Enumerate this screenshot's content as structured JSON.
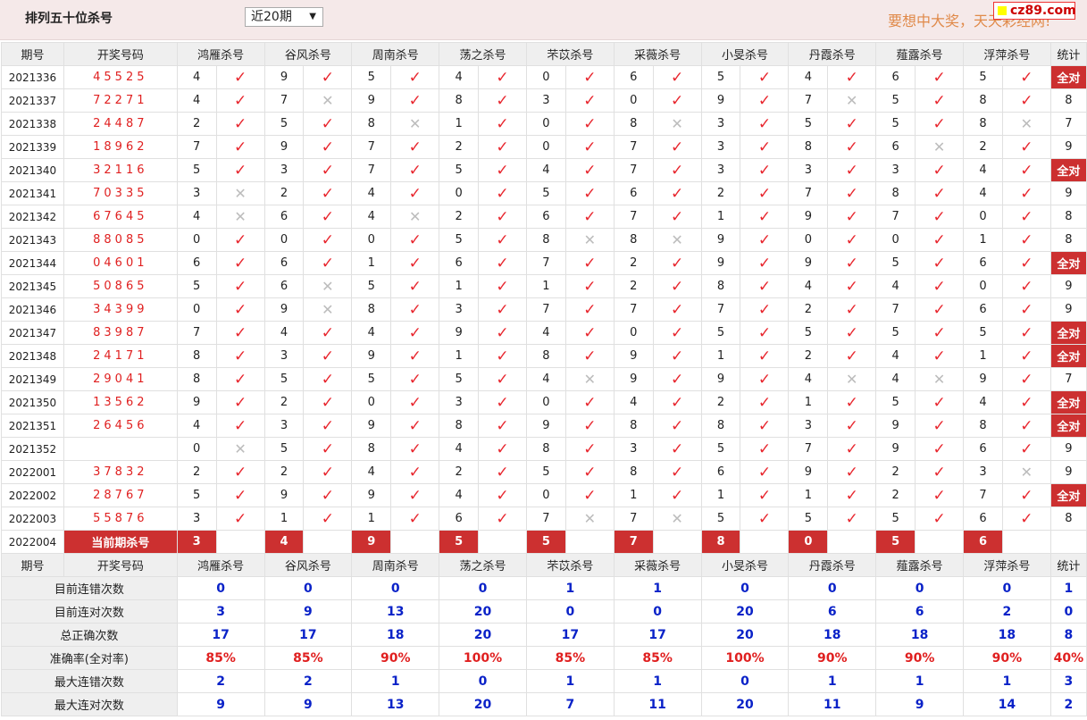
{
  "header": {
    "title": "排列五十位杀号",
    "select_value": "近20期",
    "slogan": "要想中大奖，天天彩经网!",
    "logo_text": "cz89.com"
  },
  "columns": {
    "issue": "期号",
    "numbers": "开奖号码",
    "experts": [
      "鸿雁杀号",
      "谷风杀号",
      "周南杀号",
      "荡之杀号",
      "芣苡杀号",
      "采薇杀号",
      "小旻杀号",
      "丹霞杀号",
      "薤露杀号",
      "浮萍杀号"
    ],
    "stat": "统计"
  },
  "rows": [
    {
      "issue": "2021336",
      "nums": "45525",
      "k": [
        4,
        9,
        5,
        4,
        0,
        6,
        5,
        4,
        6,
        5
      ],
      "r": [
        1,
        1,
        1,
        1,
        1,
        1,
        1,
        1,
        1,
        1
      ],
      "stat": "全对"
    },
    {
      "issue": "2021337",
      "nums": "72271",
      "k": [
        4,
        7,
        9,
        8,
        3,
        0,
        9,
        7,
        5,
        8
      ],
      "r": [
        1,
        0,
        1,
        1,
        1,
        1,
        1,
        0,
        1,
        1
      ],
      "stat": "8"
    },
    {
      "issue": "2021338",
      "nums": "24487",
      "k": [
        2,
        5,
        8,
        1,
        0,
        8,
        3,
        5,
        5,
        8
      ],
      "r": [
        1,
        1,
        0,
        1,
        1,
        0,
        1,
        1,
        1,
        0
      ],
      "stat": "7"
    },
    {
      "issue": "2021339",
      "nums": "18962",
      "k": [
        7,
        9,
        7,
        2,
        0,
        7,
        3,
        8,
        6,
        2
      ],
      "r": [
        1,
        1,
        1,
        1,
        1,
        1,
        1,
        1,
        0,
        1
      ],
      "stat": "9"
    },
    {
      "issue": "2021340",
      "nums": "32116",
      "k": [
        5,
        3,
        7,
        5,
        4,
        7,
        3,
        3,
        3,
        4
      ],
      "r": [
        1,
        1,
        1,
        1,
        1,
        1,
        1,
        1,
        1,
        1
      ],
      "stat": "全对"
    },
    {
      "issue": "2021341",
      "nums": "70335",
      "k": [
        3,
        2,
        4,
        0,
        5,
        6,
        2,
        7,
        8,
        4
      ],
      "r": [
        0,
        1,
        1,
        1,
        1,
        1,
        1,
        1,
        1,
        1
      ],
      "stat": "9"
    },
    {
      "issue": "2021342",
      "nums": "67645",
      "k": [
        4,
        6,
        4,
        2,
        6,
        7,
        1,
        9,
        7,
        0
      ],
      "r": [
        0,
        1,
        0,
        1,
        1,
        1,
        1,
        1,
        1,
        1
      ],
      "stat": "8"
    },
    {
      "issue": "2021343",
      "nums": "88085",
      "k": [
        0,
        0,
        0,
        5,
        8,
        8,
        9,
        0,
        0,
        1
      ],
      "r": [
        1,
        1,
        1,
        1,
        0,
        0,
        1,
        1,
        1,
        1
      ],
      "stat": "8"
    },
    {
      "issue": "2021344",
      "nums": "04601",
      "k": [
        6,
        6,
        1,
        6,
        7,
        2,
        9,
        9,
        5,
        6
      ],
      "r": [
        1,
        1,
        1,
        1,
        1,
        1,
        1,
        1,
        1,
        1
      ],
      "stat": "全对"
    },
    {
      "issue": "2021345",
      "nums": "50865",
      "k": [
        5,
        6,
        5,
        1,
        1,
        2,
        8,
        4,
        4,
        0
      ],
      "r": [
        1,
        0,
        1,
        1,
        1,
        1,
        1,
        1,
        1,
        1
      ],
      "stat": "9"
    },
    {
      "issue": "2021346",
      "nums": "34399",
      "k": [
        0,
        9,
        8,
        3,
        7,
        7,
        7,
        2,
        7,
        6
      ],
      "r": [
        1,
        0,
        1,
        1,
        1,
        1,
        1,
        1,
        1,
        1
      ],
      "stat": "9"
    },
    {
      "issue": "2021347",
      "nums": "83987",
      "k": [
        7,
        4,
        4,
        9,
        4,
        0,
        5,
        5,
        5,
        5
      ],
      "r": [
        1,
        1,
        1,
        1,
        1,
        1,
        1,
        1,
        1,
        1
      ],
      "stat": "全对"
    },
    {
      "issue": "2021348",
      "nums": "24171",
      "k": [
        8,
        3,
        9,
        1,
        8,
        9,
        1,
        2,
        4,
        1
      ],
      "r": [
        1,
        1,
        1,
        1,
        1,
        1,
        1,
        1,
        1,
        1
      ],
      "stat": "全对"
    },
    {
      "issue": "2021349",
      "nums": "29041",
      "k": [
        8,
        5,
        5,
        5,
        4,
        9,
        9,
        4,
        4,
        9
      ],
      "r": [
        1,
        1,
        1,
        1,
        0,
        1,
        1,
        0,
        0,
        1
      ],
      "stat": "7"
    },
    {
      "issue": "2021350",
      "nums": "13562",
      "k": [
        9,
        2,
        0,
        3,
        0,
        4,
        2,
        1,
        5,
        4
      ],
      "r": [
        1,
        1,
        1,
        1,
        1,
        1,
        1,
        1,
        1,
        1
      ],
      "stat": "全对"
    },
    {
      "issue": "2021351",
      "nums": "26456",
      "k": [
        4,
        3,
        9,
        8,
        9,
        8,
        8,
        3,
        9,
        8
      ],
      "r": [
        1,
        1,
        1,
        1,
        1,
        1,
        1,
        1,
        1,
        1
      ],
      "stat": "全对"
    },
    {
      "issue": "2021352",
      "nums": "",
      "k": [
        0,
        5,
        8,
        4,
        8,
        3,
        5,
        7,
        9,
        6
      ],
      "r": [
        0,
        1,
        1,
        1,
        1,
        1,
        1,
        1,
        1,
        1
      ],
      "stat": "9"
    },
    {
      "issue": "2022001",
      "nums": "37832",
      "k": [
        2,
        2,
        4,
        2,
        5,
        8,
        6,
        9,
        2,
        3
      ],
      "r": [
        1,
        1,
        1,
        1,
        1,
        1,
        1,
        1,
        1,
        0
      ],
      "stat": "9"
    },
    {
      "issue": "2022002",
      "nums": "28767",
      "k": [
        5,
        9,
        9,
        4,
        0,
        1,
        1,
        1,
        2,
        7
      ],
      "r": [
        1,
        1,
        1,
        1,
        1,
        1,
        1,
        1,
        1,
        1
      ],
      "stat": "全对"
    },
    {
      "issue": "2022003",
      "nums": "55876",
      "k": [
        3,
        1,
        1,
        6,
        7,
        7,
        5,
        5,
        5,
        6
      ],
      "r": [
        1,
        1,
        1,
        1,
        0,
        0,
        1,
        1,
        1,
        1
      ],
      "stat": "8"
    }
  ],
  "current": {
    "issue": "2022004",
    "label": "当前期杀号",
    "k": [
      3,
      4,
      9,
      5,
      5,
      7,
      8,
      0,
      5,
      6
    ]
  },
  "stats": [
    {
      "label": "目前连错次数",
      "vals": [
        "0",
        "0",
        "0",
        "0",
        "1",
        "1",
        "0",
        "0",
        "0",
        "0"
      ],
      "stat": "1"
    },
    {
      "label": "目前连对次数",
      "vals": [
        "3",
        "9",
        "13",
        "20",
        "0",
        "0",
        "20",
        "6",
        "6",
        "2"
      ],
      "stat": "0"
    },
    {
      "label": "总正确次数",
      "vals": [
        "17",
        "17",
        "18",
        "20",
        "17",
        "17",
        "20",
        "18",
        "18",
        "18"
      ],
      "stat": "8"
    },
    {
      "label": "准确率(全对率)",
      "vals": [
        "85%",
        "85%",
        "90%",
        "100%",
        "85%",
        "85%",
        "100%",
        "90%",
        "90%",
        "90%"
      ],
      "stat": "40%",
      "rate": true
    },
    {
      "label": "最大连错次数",
      "vals": [
        "2",
        "2",
        "1",
        "0",
        "1",
        "1",
        "0",
        "1",
        "1",
        "1"
      ],
      "stat": "3"
    },
    {
      "label": "最大连对次数",
      "vals": [
        "9",
        "9",
        "13",
        "20",
        "7",
        "11",
        "20",
        "11",
        "9",
        "14"
      ],
      "stat": "2"
    }
  ],
  "marks": {
    "ok": "✓",
    "no": "✕"
  },
  "colors": {
    "accent": "#cc3030",
    "ok": "#e8262e",
    "stat_value": "#0a22c8"
  }
}
